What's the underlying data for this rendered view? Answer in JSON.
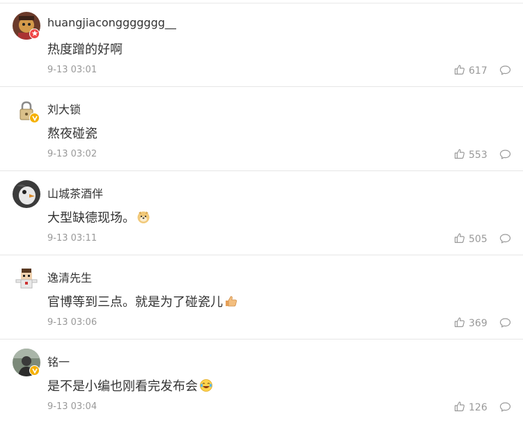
{
  "comments": [
    {
      "username": "huangjiaconggggggg__",
      "text": "热度蹭的好啊",
      "time": "9-13 03:01",
      "likes": "617",
      "avatar_icon": "cartoon-avatar",
      "badge_icon": "red-star-badge",
      "badge_color": "#f04646",
      "emoji": null
    },
    {
      "username": "刘大锁",
      "text": "熬夜碰瓷",
      "time": "9-13 03:02",
      "likes": "553",
      "avatar_icon": "lock-avatar",
      "badge_icon": "verified-v-badge",
      "badge_color": "#f5b000",
      "emoji": null
    },
    {
      "username": "山城茶酒伴",
      "text": "大型缺德现场。",
      "time": "9-13 03:11",
      "likes": "505",
      "avatar_icon": "bird-avatar",
      "badge_icon": null,
      "emoji": "doge-emoji"
    },
    {
      "username": "逸清先生",
      "text": "官博等到三点。就是为了碰瓷儿",
      "time": "9-13 03:06",
      "likes": "369",
      "avatar_icon": "pixel-character-avatar",
      "badge_icon": null,
      "emoji": "thumbs-up-emoji"
    },
    {
      "username": "铭一",
      "text": "是不是小编也刚看完发布会",
      "time": "9-13 03:04",
      "likes": "126",
      "avatar_icon": "photo-avatar",
      "badge_icon": "verified-v-badge",
      "badge_color": "#f5b000",
      "emoji": "laughing-tears-emoji"
    }
  ],
  "colors": {
    "text": "#333333",
    "meta": "#999999",
    "divider": "#e6e6e6"
  }
}
